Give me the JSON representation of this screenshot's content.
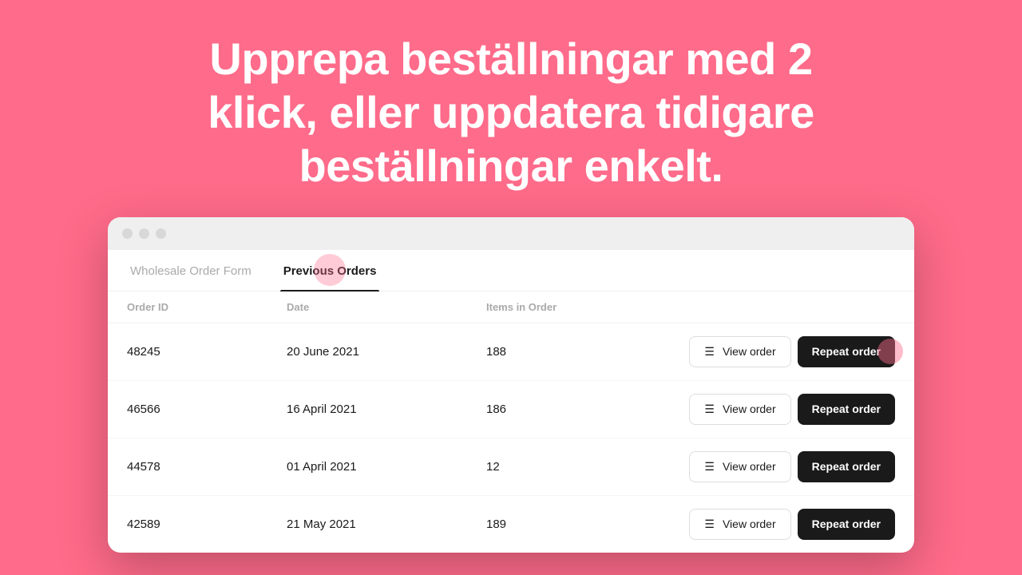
{
  "background_color": "#FF6B8A",
  "headline": {
    "line1": "Upprepa beställningar med 2",
    "line2": "klick, eller uppdatera tidigare",
    "line3": "beställningar enkelt."
  },
  "browser": {
    "dots": [
      "dot1",
      "dot2",
      "dot3"
    ]
  },
  "tabs": [
    {
      "id": "wholesale",
      "label": "Wholesale Order Form",
      "active": false
    },
    {
      "id": "previous",
      "label": "Previous Orders",
      "active": true
    }
  ],
  "table": {
    "headers": [
      "Order ID",
      "Date",
      "Items in Order",
      "",
      ""
    ],
    "rows": [
      {
        "id": "48245",
        "date": "20 June 2021",
        "items": "188",
        "highlighted": true
      },
      {
        "id": "46566",
        "date": "16 April 2021",
        "items": "186",
        "highlighted": false
      },
      {
        "id": "44578",
        "date": "01 April 2021",
        "items": "12",
        "highlighted": false
      },
      {
        "id": "42589",
        "date": "21 May 2021",
        "items": "189",
        "highlighted": false
      }
    ],
    "view_btn_label": "View order",
    "repeat_btn_label": "Repeat order"
  }
}
